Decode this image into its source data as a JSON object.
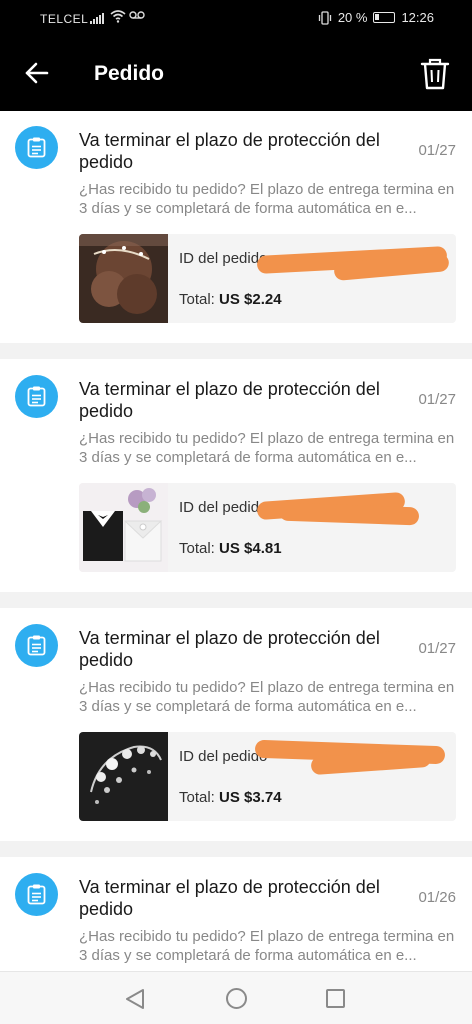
{
  "status_bar": {
    "carrier": "TELCEL",
    "battery": "20 %",
    "time": "12:26"
  },
  "header": {
    "title": "Pedido"
  },
  "messages": [
    {
      "title": "Va terminar el plazo de protección del pedido",
      "date": "01/27",
      "body": "¿Has recibido tu pedido? El plazo de entrega termina en 3 días y se completará de forma automática en e...",
      "order_id_label": "ID del pedido",
      "total_label": "Total:",
      "total_value": "US $2.24",
      "thumb": "hair-accessory"
    },
    {
      "title": "Va terminar el plazo de protección del pedido",
      "date": "01/27",
      "body": "¿Has recibido tu pedido? El plazo de entrega termina en 3 días y se completará de forma automática en e...",
      "order_id_label": "ID del pedido",
      "total_label": "Total:",
      "total_value": "US $4.81",
      "thumb": "wedding-favor-boxes"
    },
    {
      "title": "Va terminar el plazo de protección del pedido",
      "date": "01/27",
      "body": "¿Has recibido tu pedido? El plazo de entrega termina en 3 días y se completará de forma automática en e...",
      "order_id_label": "ID del pedido",
      "total_label": "Total:",
      "total_value": "US $3.74",
      "thumb": "pearl-hair-vine"
    },
    {
      "title": "Va terminar el plazo de protección del pedido",
      "date": "01/26",
      "body": "¿Has recibido tu pedido? El plazo de entrega termina en 3 días y se completará de forma automática en e..."
    }
  ],
  "colors": {
    "accent": "#2eaef0",
    "header_bg": "#000000",
    "redaction": "#f2924b"
  }
}
